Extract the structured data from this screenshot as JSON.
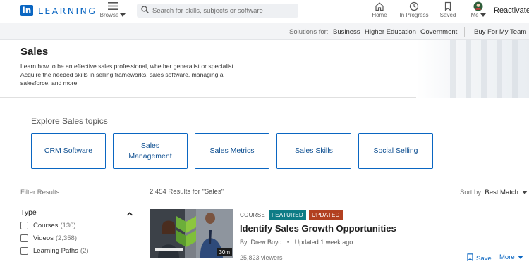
{
  "app": {
    "logo_letters": "in",
    "logo_text": "LEARNING"
  },
  "nav": {
    "browse_label": "Browse",
    "search_placeholder": "Search for skills, subjects or software",
    "home_label": "Home",
    "in_progress_label": "In Progress",
    "saved_label": "Saved",
    "me_label": "Me",
    "reactivate_label": "Reactivate"
  },
  "subbar": {
    "solutions_for": "Solutions for:",
    "links": [
      "Business",
      "Higher Education",
      "Government"
    ],
    "buy_label": "Buy For My Team"
  },
  "hero": {
    "title": "Sales",
    "description": "Learn how to be an effective sales professional, whether generalist or specialist. Acquire the needed skills in selling frameworks, sales software, managing a salesforce, and more."
  },
  "explore": {
    "title": "Explore Sales topics",
    "topics": [
      "CRM Software",
      "Sales Management",
      "Sales Metrics",
      "Sales Skills",
      "Social Selling"
    ]
  },
  "filters": {
    "title": "Filter Results",
    "type_label": "Type",
    "options": [
      {
        "label": "Courses",
        "count": "(130)"
      },
      {
        "label": "Videos",
        "count": "(2,358)"
      },
      {
        "label": "Learning Paths",
        "count": "(2)"
      }
    ]
  },
  "results": {
    "count_text": "2,454 Results for \"Sales\"",
    "sort_label": "Sort by:",
    "sort_value": "Best Match",
    "items": [
      {
        "type": "COURSE",
        "badges": [
          {
            "text": "FEATURED",
            "color": "#0e7c86"
          },
          {
            "text": "UPDATED",
            "color": "#b24020"
          }
        ],
        "title": "Identify Sales Growth Opportunities",
        "author": "By: Drew Boyd",
        "updated": "Updated 1 week ago",
        "viewers": "25,823 viewers",
        "duration": "30m",
        "save_label": "Save",
        "more_label": "More"
      }
    ]
  },
  "colors": {
    "brand": "#0a66c2",
    "featured": "#0e7c86",
    "updated": "#b24020"
  }
}
